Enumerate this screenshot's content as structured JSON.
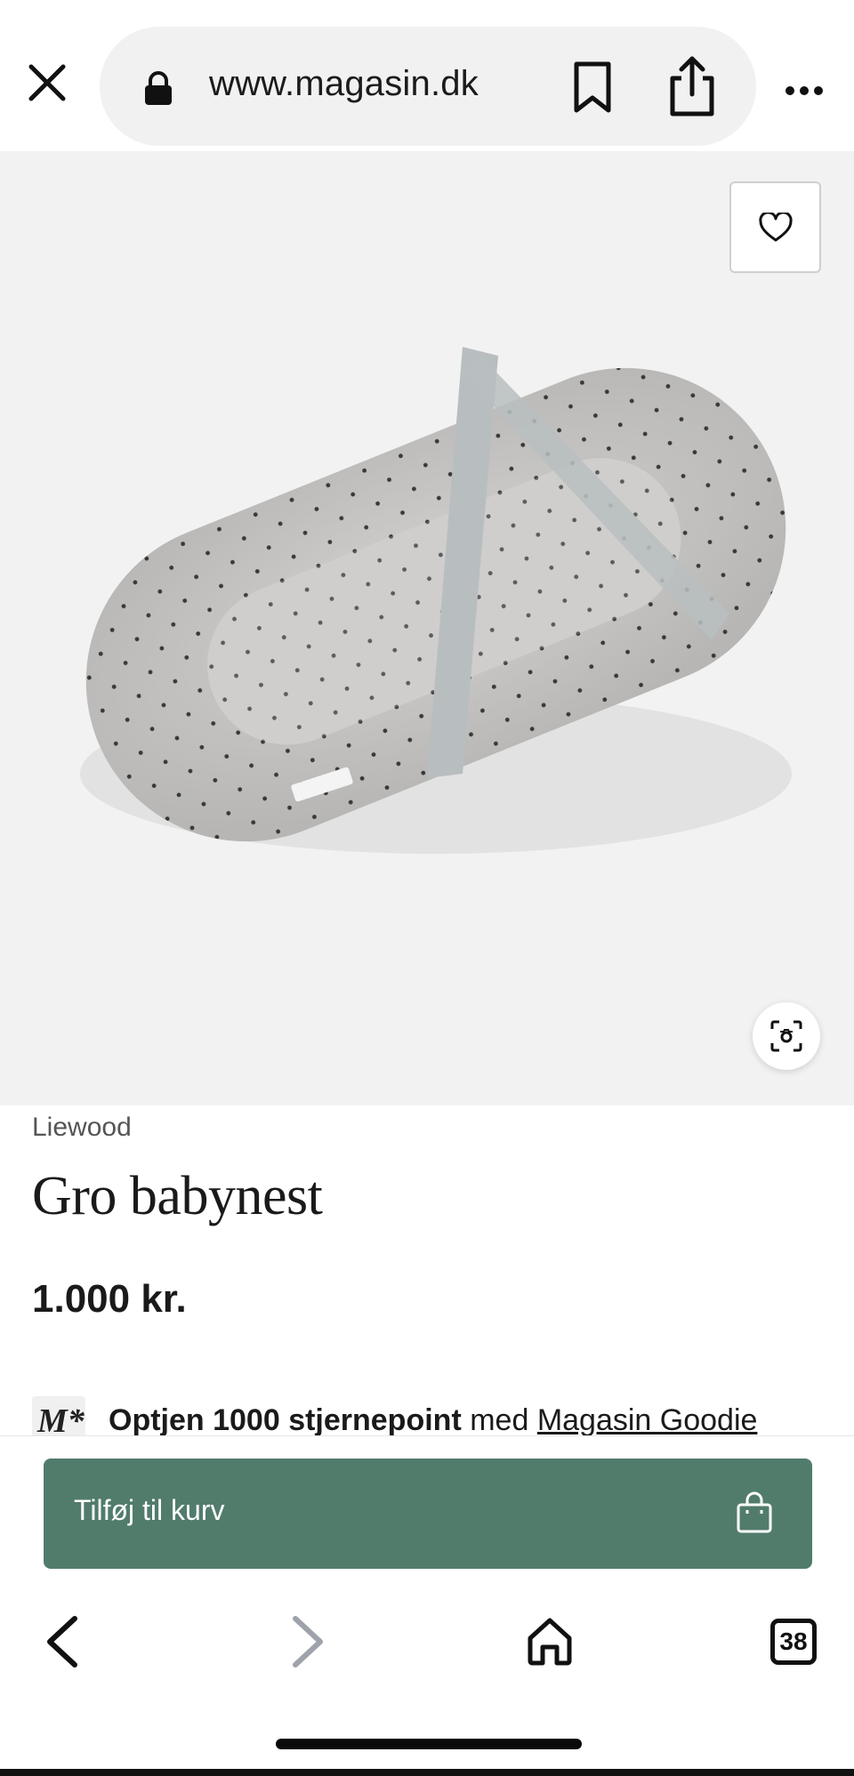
{
  "browser": {
    "url": "www.magasin.dk",
    "tab_count": "38"
  },
  "product": {
    "brand": "Liewood",
    "title": "Gro babynest",
    "price": "1.000 kr.",
    "badge_logo": "M*"
  },
  "points": {
    "bold_text": "Optjen 1000 stjernepoint",
    "mid_text": " med ",
    "link_text": "Magasin Goodie"
  },
  "cart": {
    "button_label": "Tilføj til kurv",
    "button_color": "#517c6c"
  },
  "icons": {
    "close": "close-icon",
    "lock": "lock-icon",
    "bookmark": "bookmark-icon",
    "share": "share-icon",
    "more": "more-icon",
    "favorite": "heart-icon",
    "visual_search": "visual-search-icon",
    "bag": "shopping-bag-icon",
    "back": "chevron-left-icon",
    "forward": "chevron-right-icon",
    "home": "home-icon"
  }
}
